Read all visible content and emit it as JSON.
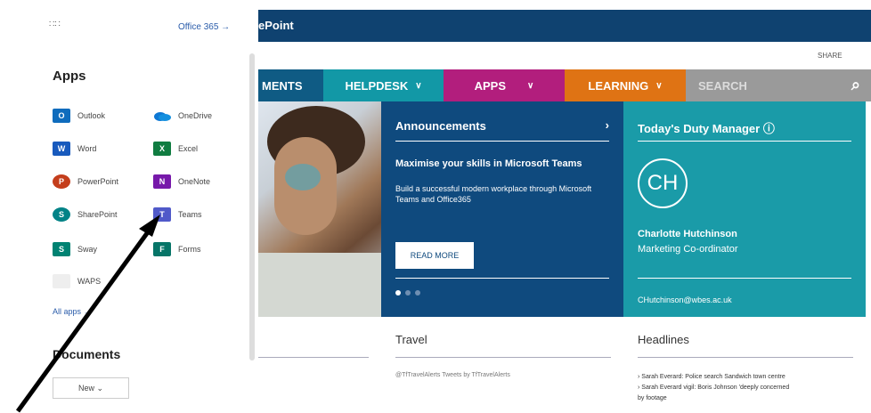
{
  "sharepoint": {
    "title": "ePoint",
    "share": "SHARE",
    "nav": [
      {
        "label": "MENTS"
      },
      {
        "label": "HELPDESK"
      },
      {
        "label": "APPS"
      },
      {
        "label": "LEARNING"
      }
    ],
    "search_placeholder": "SEARCH",
    "announcements": {
      "heading": "Announcements",
      "subheading": "Maximise your skills in Microsoft Teams",
      "body": "Build a successful modern workplace through Microsoft Teams and Office365",
      "read_more": "READ MORE"
    },
    "duty": {
      "heading": "Today's Duty Manager",
      "initials": "CH",
      "name": "Charlotte Hutchinson",
      "role": "Marketing Co-ordinator",
      "email": "CHutchinson@wbes.ac.uk"
    },
    "travel": {
      "heading": "Travel",
      "tweets": "@TfTravelAlerts Tweets by TfTravelAlerts"
    },
    "headlines": {
      "heading": "Headlines",
      "items": [
        "Sarah Everard: Police search Sandwich town centre",
        "Sarah Everard vigil: Boris Johnson 'deeply concerned",
        "by footage"
      ]
    }
  },
  "launcher": {
    "office_link": "Office 365 →",
    "apps_title": "Apps",
    "apps": [
      {
        "name": "Outlook",
        "letter": "O",
        "color": "#0f6cbd"
      },
      {
        "name": "OneDrive",
        "letter": "",
        "color": "#0f78d4"
      },
      {
        "name": "Word",
        "letter": "W",
        "color": "#185abd"
      },
      {
        "name": "Excel",
        "letter": "X",
        "color": "#107c41"
      },
      {
        "name": "PowerPoint",
        "letter": "P",
        "color": "#c43e1c"
      },
      {
        "name": "OneNote",
        "letter": "N",
        "color": "#7719aa"
      },
      {
        "name": "SharePoint",
        "letter": "S",
        "color": "#038387"
      },
      {
        "name": "Teams",
        "letter": "T",
        "color": "#5059c9"
      },
      {
        "name": "Sway",
        "letter": "S",
        "color": "#008272"
      },
      {
        "name": "Forms",
        "letter": "F",
        "color": "#077568"
      },
      {
        "name": "WAPS",
        "letter": "",
        "color": "#e8e8e8"
      }
    ],
    "all_apps": "All apps →",
    "documents_title": "Documents",
    "new_button": "New ⌄"
  }
}
